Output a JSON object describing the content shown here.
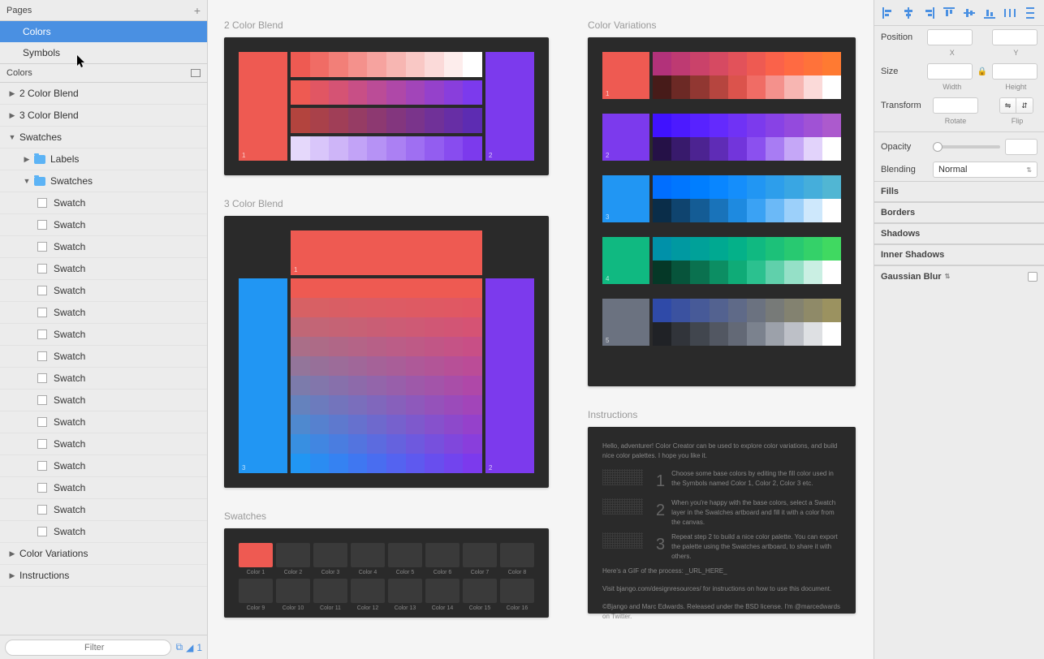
{
  "pages": {
    "header": "Pages",
    "items": [
      "Colors",
      "Symbols"
    ],
    "selected": 0
  },
  "layers": {
    "header": "Colors",
    "tree": [
      {
        "label": "2 Color Blend",
        "type": "artboard",
        "depth": 0,
        "expanded": false
      },
      {
        "label": "3 Color Blend",
        "type": "artboard",
        "depth": 0,
        "expanded": false
      },
      {
        "label": "Swatches",
        "type": "artboard",
        "depth": 0,
        "expanded": true
      },
      {
        "label": "Labels",
        "type": "folder",
        "depth": 1,
        "expanded": false
      },
      {
        "label": "Swatches",
        "type": "folder",
        "depth": 1,
        "expanded": true
      },
      {
        "label": "Swatch",
        "type": "layer",
        "depth": 2
      },
      {
        "label": "Swatch",
        "type": "layer",
        "depth": 2
      },
      {
        "label": "Swatch",
        "type": "layer",
        "depth": 2
      },
      {
        "label": "Swatch",
        "type": "layer",
        "depth": 2
      },
      {
        "label": "Swatch",
        "type": "layer",
        "depth": 2
      },
      {
        "label": "Swatch",
        "type": "layer",
        "depth": 2
      },
      {
        "label": "Swatch",
        "type": "layer",
        "depth": 2
      },
      {
        "label": "Swatch",
        "type": "layer",
        "depth": 2
      },
      {
        "label": "Swatch",
        "type": "layer",
        "depth": 2
      },
      {
        "label": "Swatch",
        "type": "layer",
        "depth": 2
      },
      {
        "label": "Swatch",
        "type": "layer",
        "depth": 2
      },
      {
        "label": "Swatch",
        "type": "layer",
        "depth": 2
      },
      {
        "label": "Swatch",
        "type": "layer",
        "depth": 2
      },
      {
        "label": "Swatch",
        "type": "layer",
        "depth": 2
      },
      {
        "label": "Swatch",
        "type": "layer",
        "depth": 2
      },
      {
        "label": "Swatch",
        "type": "layer",
        "depth": 2
      },
      {
        "label": "Color Variations",
        "type": "artboard",
        "depth": 0,
        "expanded": false
      },
      {
        "label": "Instructions",
        "type": "artboard",
        "depth": 0,
        "expanded": false
      }
    ]
  },
  "filter": {
    "placeholder": "Filter",
    "count": "1"
  },
  "artboards": {
    "blend2": {
      "title": "2 Color Blend",
      "num1": "1",
      "num2": "2"
    },
    "blend3": {
      "title": "3 Color Blend",
      "num1": "1",
      "num2": "2",
      "num3": "3"
    },
    "swatches": {
      "title": "Swatches",
      "labels": [
        "Color 1",
        "Color 2",
        "Color 3",
        "Color 4",
        "Color 5",
        "Color 6",
        "Color 7",
        "Color 8",
        "Color 9",
        "Color 10",
        "Color 11",
        "Color 12",
        "Color 13",
        "Color 14",
        "Color 15",
        "Color 16"
      ]
    },
    "variations": {
      "title": "Color Variations",
      "rows": [
        {
          "num": "1",
          "base": "#ee5a52"
        },
        {
          "num": "2",
          "base": "#7c3aed"
        },
        {
          "num": "3",
          "base": "#2196f3"
        },
        {
          "num": "4",
          "base": "#10b981"
        },
        {
          "num": "5",
          "base": "#6b7280"
        }
      ]
    },
    "instructions": {
      "title": "Instructions",
      "intro": "Hello, adventurer! Color Creator can be used to explore color variations, and build nice color palettes. I hope you like it.",
      "steps": [
        "Choose some base colors by editing the fill color used in the Symbols named Color 1, Color 2, Color 3 etc.",
        "When you're happy with the base colors, select a Swatch layer in the Swatches artboard and fill it with a color from the canvas.",
        "Repeat step 2 to build a nice color palette. You can export the palette using the Swatches artboard, to share it with others."
      ],
      "gif": "Here's a GIF of the process: _URL_HERE_",
      "footer1": "Visit bjango.com/designresources/ for instructions on how to use this document.",
      "footer2": "©Bjango and Marc Edwards. Released under the BSD license. I'm @marcedwards on Twitter."
    }
  },
  "inspector": {
    "position": {
      "label": "Position",
      "x": "X",
      "y": "Y"
    },
    "size": {
      "label": "Size",
      "w": "Width",
      "h": "Height"
    },
    "transform": {
      "label": "Transform",
      "rotate": "Rotate",
      "flip": "Flip"
    },
    "opacity": {
      "label": "Opacity"
    },
    "blending": {
      "label": "Blending",
      "value": "Normal"
    },
    "sections": [
      "Fills",
      "Borders",
      "Shadows",
      "Inner Shadows",
      "Gaussian Blur"
    ]
  },
  "colors": {
    "red": "#ee5a52",
    "purple": "#7c3aed",
    "blue": "#2196f3",
    "green": "#10b981",
    "gray": "#6b7280"
  }
}
